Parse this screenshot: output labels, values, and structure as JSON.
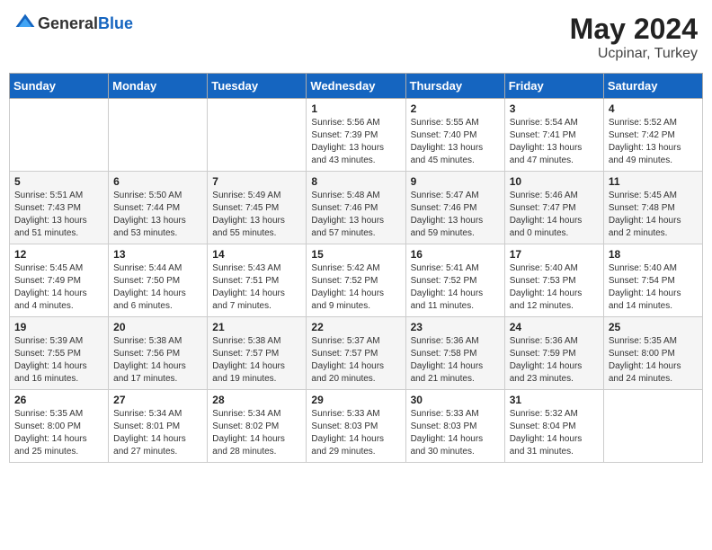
{
  "header": {
    "logo_general": "General",
    "logo_blue": "Blue",
    "title": "May 2024",
    "location": "Ucpinar, Turkey"
  },
  "days_of_week": [
    "Sunday",
    "Monday",
    "Tuesday",
    "Wednesday",
    "Thursday",
    "Friday",
    "Saturday"
  ],
  "weeks": [
    [
      {
        "day": "",
        "info": ""
      },
      {
        "day": "",
        "info": ""
      },
      {
        "day": "",
        "info": ""
      },
      {
        "day": "1",
        "info": "Sunrise: 5:56 AM\nSunset: 7:39 PM\nDaylight: 13 hours\nand 43 minutes."
      },
      {
        "day": "2",
        "info": "Sunrise: 5:55 AM\nSunset: 7:40 PM\nDaylight: 13 hours\nand 45 minutes."
      },
      {
        "day": "3",
        "info": "Sunrise: 5:54 AM\nSunset: 7:41 PM\nDaylight: 13 hours\nand 47 minutes."
      },
      {
        "day": "4",
        "info": "Sunrise: 5:52 AM\nSunset: 7:42 PM\nDaylight: 13 hours\nand 49 minutes."
      }
    ],
    [
      {
        "day": "5",
        "info": "Sunrise: 5:51 AM\nSunset: 7:43 PM\nDaylight: 13 hours\nand 51 minutes."
      },
      {
        "day": "6",
        "info": "Sunrise: 5:50 AM\nSunset: 7:44 PM\nDaylight: 13 hours\nand 53 minutes."
      },
      {
        "day": "7",
        "info": "Sunrise: 5:49 AM\nSunset: 7:45 PM\nDaylight: 13 hours\nand 55 minutes."
      },
      {
        "day": "8",
        "info": "Sunrise: 5:48 AM\nSunset: 7:46 PM\nDaylight: 13 hours\nand 57 minutes."
      },
      {
        "day": "9",
        "info": "Sunrise: 5:47 AM\nSunset: 7:46 PM\nDaylight: 13 hours\nand 59 minutes."
      },
      {
        "day": "10",
        "info": "Sunrise: 5:46 AM\nSunset: 7:47 PM\nDaylight: 14 hours\nand 0 minutes."
      },
      {
        "day": "11",
        "info": "Sunrise: 5:45 AM\nSunset: 7:48 PM\nDaylight: 14 hours\nand 2 minutes."
      }
    ],
    [
      {
        "day": "12",
        "info": "Sunrise: 5:45 AM\nSunset: 7:49 PM\nDaylight: 14 hours\nand 4 minutes."
      },
      {
        "day": "13",
        "info": "Sunrise: 5:44 AM\nSunset: 7:50 PM\nDaylight: 14 hours\nand 6 minutes."
      },
      {
        "day": "14",
        "info": "Sunrise: 5:43 AM\nSunset: 7:51 PM\nDaylight: 14 hours\nand 7 minutes."
      },
      {
        "day": "15",
        "info": "Sunrise: 5:42 AM\nSunset: 7:52 PM\nDaylight: 14 hours\nand 9 minutes."
      },
      {
        "day": "16",
        "info": "Sunrise: 5:41 AM\nSunset: 7:52 PM\nDaylight: 14 hours\nand 11 minutes."
      },
      {
        "day": "17",
        "info": "Sunrise: 5:40 AM\nSunset: 7:53 PM\nDaylight: 14 hours\nand 12 minutes."
      },
      {
        "day": "18",
        "info": "Sunrise: 5:40 AM\nSunset: 7:54 PM\nDaylight: 14 hours\nand 14 minutes."
      }
    ],
    [
      {
        "day": "19",
        "info": "Sunrise: 5:39 AM\nSunset: 7:55 PM\nDaylight: 14 hours\nand 16 minutes."
      },
      {
        "day": "20",
        "info": "Sunrise: 5:38 AM\nSunset: 7:56 PM\nDaylight: 14 hours\nand 17 minutes."
      },
      {
        "day": "21",
        "info": "Sunrise: 5:38 AM\nSunset: 7:57 PM\nDaylight: 14 hours\nand 19 minutes."
      },
      {
        "day": "22",
        "info": "Sunrise: 5:37 AM\nSunset: 7:57 PM\nDaylight: 14 hours\nand 20 minutes."
      },
      {
        "day": "23",
        "info": "Sunrise: 5:36 AM\nSunset: 7:58 PM\nDaylight: 14 hours\nand 21 minutes."
      },
      {
        "day": "24",
        "info": "Sunrise: 5:36 AM\nSunset: 7:59 PM\nDaylight: 14 hours\nand 23 minutes."
      },
      {
        "day": "25",
        "info": "Sunrise: 5:35 AM\nSunset: 8:00 PM\nDaylight: 14 hours\nand 24 minutes."
      }
    ],
    [
      {
        "day": "26",
        "info": "Sunrise: 5:35 AM\nSunset: 8:00 PM\nDaylight: 14 hours\nand 25 minutes."
      },
      {
        "day": "27",
        "info": "Sunrise: 5:34 AM\nSunset: 8:01 PM\nDaylight: 14 hours\nand 27 minutes."
      },
      {
        "day": "28",
        "info": "Sunrise: 5:34 AM\nSunset: 8:02 PM\nDaylight: 14 hours\nand 28 minutes."
      },
      {
        "day": "29",
        "info": "Sunrise: 5:33 AM\nSunset: 8:03 PM\nDaylight: 14 hours\nand 29 minutes."
      },
      {
        "day": "30",
        "info": "Sunrise: 5:33 AM\nSunset: 8:03 PM\nDaylight: 14 hours\nand 30 minutes."
      },
      {
        "day": "31",
        "info": "Sunrise: 5:32 AM\nSunset: 8:04 PM\nDaylight: 14 hours\nand 31 minutes."
      },
      {
        "day": "",
        "info": ""
      }
    ]
  ]
}
